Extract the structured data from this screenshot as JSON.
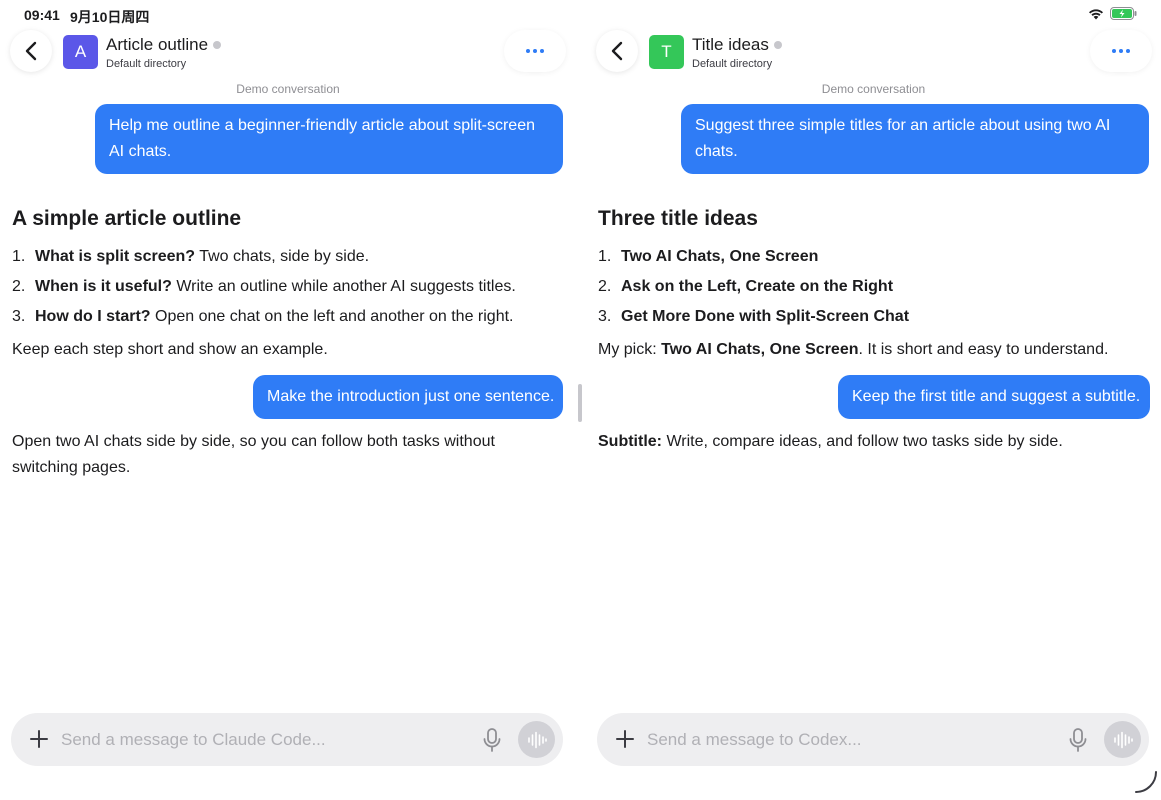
{
  "status": {
    "time": "09:41",
    "date": "9月10日周四"
  },
  "colors": {
    "accent": "#2f7cf6",
    "avatar_left": "#5b57e8",
    "avatar_right": "#34c759",
    "bubble": "#2f7cf6"
  },
  "left": {
    "avatar_letter": "A",
    "title": "Article outline",
    "subtitle": "Default directory",
    "demo_label": "Demo conversation",
    "user_message_1": "Help me outline a beginner-friendly article about split-screen AI chats.",
    "heading": "A simple article outline",
    "list": [
      {
        "num": "1.",
        "bold": "What is split screen?",
        "text": " Two chats, side by side."
      },
      {
        "num": "2.",
        "bold": "When is it useful?",
        "text": " Write an outline while another AI suggests titles."
      },
      {
        "num": "3.",
        "bold": "How do I start?",
        "text": " Open one chat on the left and another on the right."
      }
    ],
    "note": "Keep each step short and show an example.",
    "user_message_2": "Make the introduction just one sentence.",
    "reply": "Open two AI chats side by side, so you can follow both tasks without switching pages.",
    "composer_placeholder": "Send a message to Claude Code..."
  },
  "right": {
    "avatar_letter": "T",
    "title": "Title ideas",
    "subtitle": "Default directory",
    "demo_label": "Demo conversation",
    "user_message_1": "Suggest three simple titles for an article about using two AI chats.",
    "heading": "Three title ideas",
    "list": [
      {
        "num": "1.",
        "bold": "Two AI Chats, One Screen",
        "text": ""
      },
      {
        "num": "2.",
        "bold": "Ask on the Left, Create on the Right",
        "text": ""
      },
      {
        "num": "3.",
        "bold": "Get More Done with Split-Screen Chat",
        "text": ""
      }
    ],
    "pick_prefix": "My pick: ",
    "pick_bold": "Two AI Chats, One Screen",
    "pick_suffix": ". It is short and easy to understand.",
    "user_message_2": "Keep the first title and suggest a subtitle.",
    "reply_bold": "Subtitle:",
    "reply_text": " Write, compare ideas, and follow two tasks side by side.",
    "composer_placeholder": "Send a message to Codex..."
  },
  "icons": {
    "back": "chevron-left-icon",
    "more": "ellipsis-icon",
    "plus": "plus-icon",
    "mic": "microphone-icon",
    "voice": "waveform-icon",
    "wifi": "wifi-icon",
    "battery": "battery-charging-icon"
  }
}
